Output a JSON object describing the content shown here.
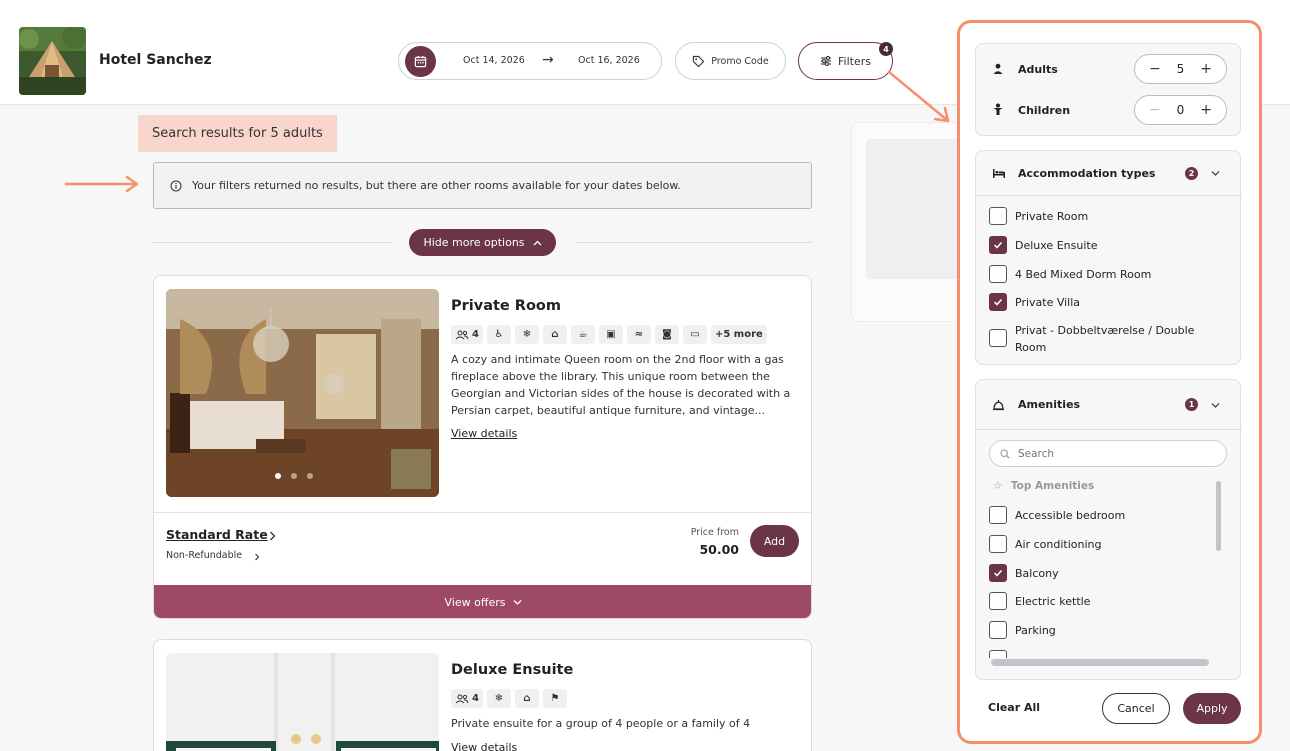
{
  "header": {
    "hotel_name": "Hotel Sanchez",
    "check_in": "Oct 14, 2026",
    "check_out": "Oct 16, 2026",
    "promo_label": "Promo Code",
    "filters_label": "Filters",
    "filters_count": "4"
  },
  "main": {
    "search_results": "Search results for 5 adults",
    "notice": "Your filters returned no results, but there are other rooms available for your dates below.",
    "hide_options": "Hide more options"
  },
  "rooms": [
    {
      "title": "Private Room",
      "guests": "4",
      "more": "+5 more",
      "description": "A cozy and intimate Queen room on the 2nd floor with a gas fireplace above the library. This unique room between the Georgian and Victorian sides of the house is decorated with a Persian carpet, beautiful antique furniture, and vintage...",
      "view_details": "View details",
      "rate_name": "Standard Rate",
      "rate_policy": "Non-Refundable",
      "price_label": "Price from",
      "price": "50.00",
      "add_label": "Add",
      "view_offers": "View offers"
    },
    {
      "title": "Deluxe Ensuite",
      "guests": "4",
      "description": "Private ensuite for a group of 4 people or a family of 4",
      "view_details": "View details"
    }
  ],
  "filters": {
    "adults_label": "Adults",
    "adults_value": "5",
    "children_label": "Children",
    "children_value": "0",
    "accommodation": {
      "title": "Accommodation types",
      "badge": "2",
      "items": [
        {
          "label": "Private Room",
          "checked": false
        },
        {
          "label": "Deluxe Ensuite",
          "checked": true
        },
        {
          "label": "4 Bed Mixed Dorm Room",
          "checked": false
        },
        {
          "label": "Private Villa",
          "checked": true
        },
        {
          "label": "Privat - Dobbeltværelse / Double Room",
          "checked": false
        }
      ]
    },
    "amenities": {
      "title": "Amenities",
      "badge": "1",
      "search_placeholder": "Search",
      "top_label": "Top Amenities",
      "items": [
        {
          "label": "Accessible bedroom",
          "checked": false
        },
        {
          "label": "Air conditioning",
          "checked": false
        },
        {
          "label": "Balcony",
          "checked": true
        },
        {
          "label": "Electric kettle",
          "checked": false
        },
        {
          "label": "Parking",
          "checked": false
        }
      ]
    },
    "clear_all": "Clear All",
    "cancel": "Cancel",
    "apply": "Apply"
  },
  "colors": {
    "brand": "#6b3448",
    "offers_bar": "#9e4a66",
    "highlight": "#f8d6cc",
    "annotation": "#f5906d"
  }
}
